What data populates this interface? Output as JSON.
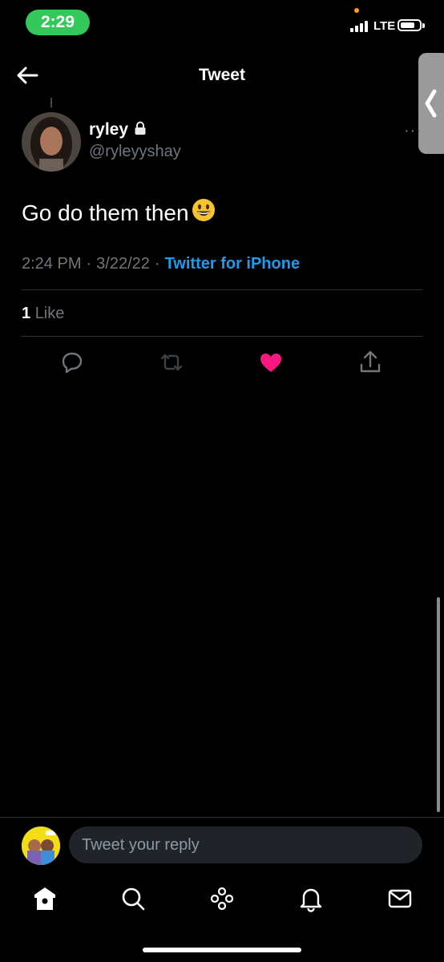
{
  "status_bar": {
    "time": "2:29",
    "network": "LTE"
  },
  "header": {
    "title": "Tweet"
  },
  "tweet": {
    "name": "ryley",
    "handle": "@ryleyyshay",
    "text": "Go do them then",
    "time": "2:24 PM",
    "date": "3/22/22",
    "separator": "·",
    "source": "Twitter for iPhone",
    "likes_count": "1",
    "likes_label": "Like",
    "liked": true,
    "more": "···"
  },
  "reply": {
    "placeholder": "Tweet your reply"
  },
  "colors": {
    "accent": "#1d9bf0",
    "like": "#f91880",
    "time_pill": "#34c759"
  },
  "icons": {
    "actions": [
      "reply-icon",
      "retweet-icon",
      "like-icon",
      "share-icon"
    ],
    "tabs": [
      "home-icon",
      "search-icon",
      "spaces-icon",
      "notifications-icon",
      "messages-icon"
    ]
  }
}
